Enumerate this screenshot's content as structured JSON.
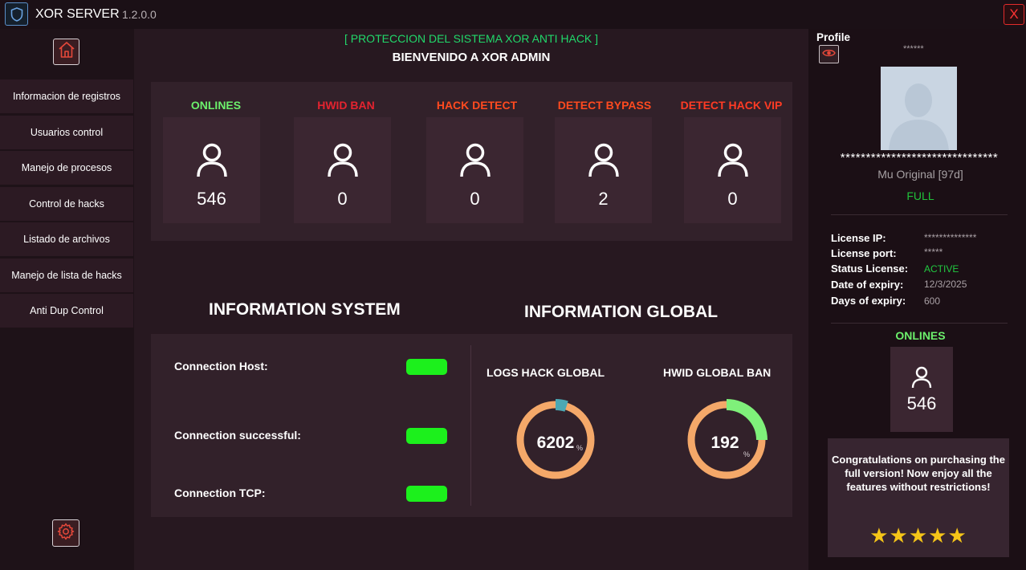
{
  "titlebar": {
    "title": "XOR SERVER",
    "version": "1.2.0.0",
    "close_label": "X",
    "logo_icon": "shield-icon"
  },
  "sidebar": {
    "home_icon": "home-icon",
    "settings_icon": "gear-icon",
    "items": [
      {
        "label": "Informacion de registros"
      },
      {
        "label": "Usuarios control"
      },
      {
        "label": "Manejo de procesos"
      },
      {
        "label": "Control de hacks"
      },
      {
        "label": "Listado de archivos"
      },
      {
        "label": "Manejo de lista de hacks"
      },
      {
        "label": "Anti Dup Control"
      }
    ]
  },
  "main": {
    "subtitle": "[ PROTECCION DEL SISTEMA XOR ANTI HACK ]",
    "title": "BIENVENIDO A XOR ADMIN",
    "stats": [
      {
        "label": "ONLINES",
        "value": "546",
        "color": "#6cf06c"
      },
      {
        "label": "HWID BAN",
        "value": "0",
        "color": "#e4232f"
      },
      {
        "label": "HACK DETECT",
        "value": "0",
        "color": "#ff4a1f"
      },
      {
        "label": "DETECT BYPASS",
        "value": "2",
        "color": "#ff4a1f"
      },
      {
        "label": "DETECT HACK VIP",
        "value": "0",
        "color": "#ff3b24"
      }
    ],
    "info_system_title": "INFORMATION SYSTEM",
    "info_global_title": "INFORMATION GLOBAL",
    "connections": [
      {
        "label": "Connection Host:",
        "status": "ok",
        "color": "#1cf01c"
      },
      {
        "label": "Connection successful:",
        "status": "ok",
        "color": "#1cf01c"
      },
      {
        "label": "Connection TCP:",
        "status": "ok",
        "color": "#1cf01c"
      }
    ],
    "gauges": [
      {
        "label": "LOGS HACK GLOBAL",
        "value": "6202",
        "unit": "%",
        "fill_fraction": 0.05,
        "track_color": "#f4a869",
        "fill_color": "#4aa8b4"
      },
      {
        "label": "HWID GLOBAL BAN",
        "value": "192",
        "unit": "%",
        "fill_fraction": 0.25,
        "track_color": "#f4a869",
        "fill_color": "#7ff07a"
      }
    ]
  },
  "profile": {
    "heading": "Profile",
    "eye_icon": "eye-icon",
    "masked_top": "******",
    "masked_line": "*******************************",
    "server_name": "Mu Original [97d]",
    "plan": "FULL",
    "license": [
      {
        "label": "License IP:",
        "value": "**************"
      },
      {
        "label": "License port:",
        "value": "*****"
      },
      {
        "label": "Status License:",
        "value": "ACTIVE"
      },
      {
        "label": "Date of expiry:",
        "value": "12/3/2025"
      },
      {
        "label": "Days of expiry:",
        "value": "600"
      }
    ],
    "onlines_title": "ONLINES",
    "onlines_value": "546",
    "congrats": "Congratulations on purchasing the full version! Now enjoy all the features without restrictions!",
    "rating": 5,
    "stars": "★★★★★"
  }
}
